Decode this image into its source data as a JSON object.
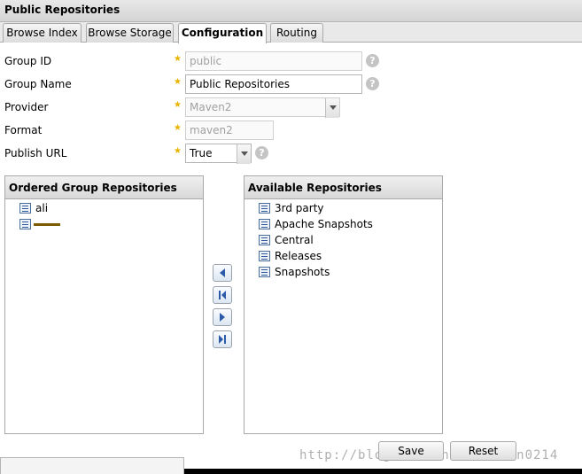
{
  "window": {
    "title": "Public Repositories"
  },
  "tabs": [
    {
      "label": "Browse Index"
    },
    {
      "label": "Browse Storage"
    },
    {
      "label": "Configuration"
    },
    {
      "label": "Routing"
    }
  ],
  "form": {
    "group_id": {
      "label": "Group ID",
      "value": "public"
    },
    "group_name": {
      "label": "Group Name",
      "value": "Public Repositories"
    },
    "provider": {
      "label": "Provider",
      "value": "Maven2"
    },
    "format": {
      "label": "Format",
      "value": "maven2"
    },
    "publish_url": {
      "label": "Publish URL",
      "value": "True"
    }
  },
  "ordered_panel": {
    "title": "Ordered Group Repositories",
    "items": [
      "ali",
      ""
    ]
  },
  "available_panel": {
    "title": "Available Repositories",
    "items": [
      "3rd party",
      "Apache Snapshots",
      "Central",
      "Releases",
      "Snapshots"
    ]
  },
  "buttons": {
    "save": "Save",
    "reset": "Reset"
  },
  "watermark": "http://blog.csdn.net/likuan0214",
  "icons": {
    "required": "star-icon",
    "help": "help-icon",
    "repo": "repository-icon",
    "move_left": "arrow-left-icon",
    "move_all_left": "arrow-first-icon",
    "move_right": "arrow-right-icon",
    "move_all_right": "arrow-last-icon"
  }
}
